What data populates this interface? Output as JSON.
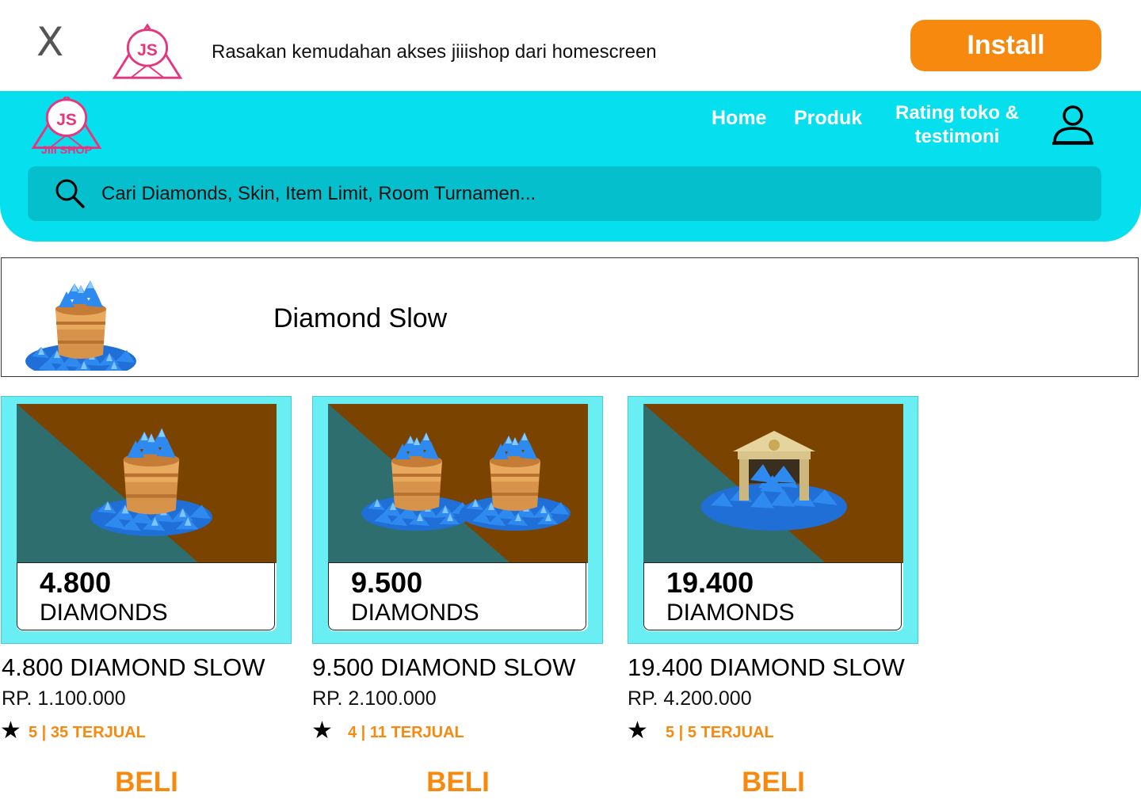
{
  "banner": {
    "close_label": "X",
    "message": "Rasakan kemudahan akses jiiishop dari homescreen",
    "install_label": "Install",
    "logo_text": "JS"
  },
  "header": {
    "logo_text": "JS",
    "logo_subtext": "JIII SHOP",
    "nav": {
      "home": "Home",
      "produk": "Produk",
      "rating_line1": "Rating toko &",
      "rating_line2": "testimoni"
    },
    "search_placeholder": "Cari Diamonds, Skin, Item Limit, Room Turnamen..."
  },
  "category": {
    "title": "Diamond Slow"
  },
  "products": [
    {
      "amount": "4.800",
      "unit": "DIAMONDS",
      "title": "4.800 DIAMOND SLOW",
      "price": "RP. 1.100.000",
      "star": "★",
      "rating": "5 | 35 TERJUAL",
      "buy_label": "BELI"
    },
    {
      "amount": "9.500",
      "unit": "DIAMONDS",
      "title": "9.500 DIAMOND SLOW",
      "price": "RP. 2.100.000",
      "star": "★",
      "rating": "4 | 11 TERJUAL",
      "buy_label": "BELI"
    },
    {
      "amount": "19.400",
      "unit": "DIAMONDS",
      "title": "19.400 DIAMOND SLOW",
      "price": "RP. 4.200.000",
      "star": "★",
      "rating": "5 | 5 TERJUAL",
      "buy_label": "BELI"
    }
  ],
  "colors": {
    "accent": "#06e0ee",
    "orange": "#f7890f",
    "card": "#68eef3",
    "brand_pink": "#e8337d"
  }
}
